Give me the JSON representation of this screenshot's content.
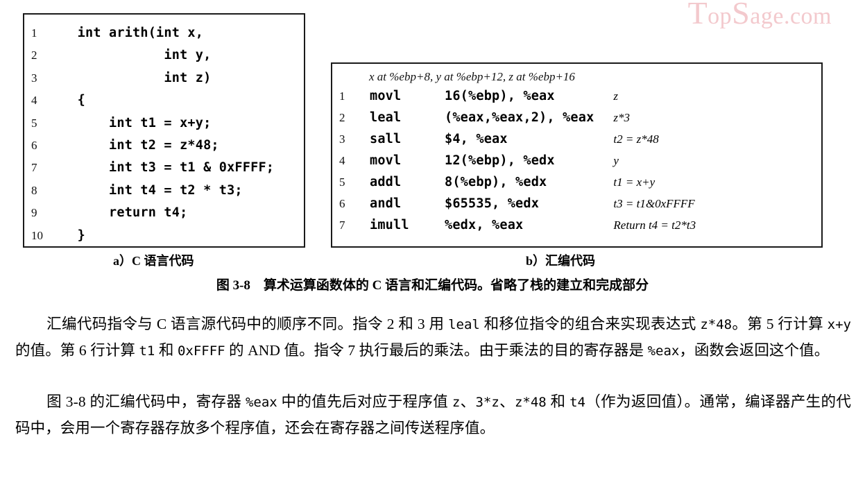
{
  "watermark": {
    "part1": "T",
    "part2": "op",
    "part3": "S",
    "part4": "age",
    "part5": ".com"
  },
  "figure": {
    "c_code": {
      "lines": [
        {
          "no": "1",
          "src": "  int arith(int x,"
        },
        {
          "no": "2",
          "src": "             int y,"
        },
        {
          "no": "3",
          "src": "             int z)"
        },
        {
          "no": "4",
          "src": "  {"
        },
        {
          "no": "5",
          "src": "      int t1 = x+y;"
        },
        {
          "no": "6",
          "src": "      int t2 = z*48;"
        },
        {
          "no": "7",
          "src": "      int t3 = t1 & 0xFFFF;"
        },
        {
          "no": "8",
          "src": "      int t4 = t2 * t3;"
        },
        {
          "no": "9",
          "src": "      return t4;"
        },
        {
          "no": "10",
          "src": "  }"
        }
      ]
    },
    "asm_code": {
      "header": "x at %ebp+8, y at %ebp+12, z at %ebp+16",
      "lines": [
        {
          "no": "1",
          "op": "movl",
          "args": "16(%ebp), %eax",
          "cmt": "z"
        },
        {
          "no": "2",
          "op": "leal",
          "args": "(%eax,%eax,2), %eax",
          "cmt": "z*3"
        },
        {
          "no": "3",
          "op": "sall",
          "args": "$4, %eax",
          "cmt": "t2 = z*48"
        },
        {
          "no": "4",
          "op": "movl",
          "args": "12(%ebp), %edx",
          "cmt": "y"
        },
        {
          "no": "5",
          "op": "addl",
          "args": "8(%ebp), %edx",
          "cmt": "t1 = x+y"
        },
        {
          "no": "6",
          "op": "andl",
          "args": "$65535, %edx",
          "cmt": "t3 = t1&0xFFFF"
        },
        {
          "no": "7",
          "op": "imull",
          "args": "%edx, %eax",
          "cmt": "Return t4 = t2*t3"
        }
      ]
    },
    "caption_a": "a）C 语言代码",
    "caption_b": "b）汇编代码",
    "figure_caption": "图 3-8　算术运算函数体的 C 语言和汇编代码。省略了栈的建立和完成部分"
  },
  "body": {
    "para1": {
      "seg1": "汇编代码指令与 C 语言源代码中的顺序不同。指令 2 和 3 用 ",
      "code1": "leal",
      "seg2": " 和移位指令的组合来实现表达式 ",
      "code2": "z*48",
      "seg3": "。第 5 行计算 ",
      "code3": "x+y",
      "seg4": " 的值。第 6 行计算 ",
      "code4": "t1",
      "seg5": " 和 ",
      "code5": "0xFFFF",
      "seg6": " 的 AND 值。指令 7 执行最后的乘法。由于乘法的目的寄存器是 ",
      "code6": "%eax",
      "seg7": "，函数会返回这个值。"
    },
    "para2": {
      "seg1": "图 3-8 的汇编代码中，寄存器 ",
      "code1": "%eax",
      "seg2": " 中的值先后对应于程序值 ",
      "code2": "z",
      "seg3": "、",
      "code3": "3*z",
      "seg4": "、",
      "code4": "z*48",
      "seg5": " 和 ",
      "code5": "t4",
      "seg6": "（作为返回值）。通常，编译器产生的代码中，会用一个寄存器存放多个程序值，还会在寄存器之间传送程序值。"
    }
  }
}
